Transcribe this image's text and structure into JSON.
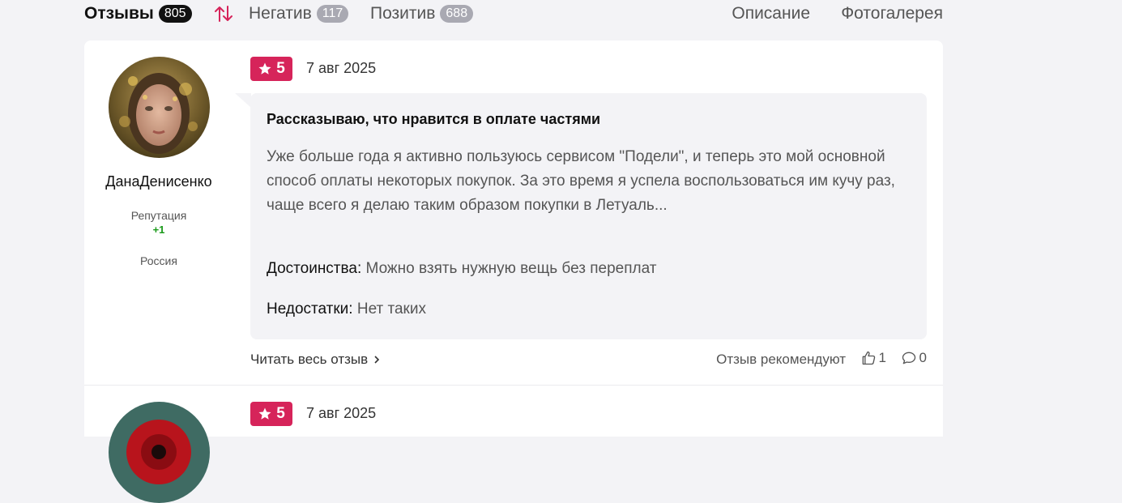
{
  "tabs": {
    "reviews": {
      "label": "Отзывы",
      "count": "805"
    },
    "negative": {
      "label": "Негатив",
      "count": "117"
    },
    "positive": {
      "label": "Позитив",
      "count": "688"
    },
    "description": "Описание",
    "gallery": "Фотогалерея"
  },
  "reviews": [
    {
      "author": "ДанаДенисенко",
      "reputation_label": "Репутация",
      "reputation_value": "+1",
      "country": "Россия",
      "rating": "5",
      "date": "7 авг 2025",
      "title": "Рассказываю, что нравится в оплате частями",
      "text": "Уже больше года я активно пользуюсь сервисом \"Подели\", и теперь это мой основной способ оплаты некоторых покупок. За это время я успела воспользоваться им кучу раз, чаще всего я делаю таким образом покупки в Летуаль...",
      "pros_label": "Достоинства:",
      "pros": "Можно взять нужную вещь без переплат",
      "cons_label": "Недостатки:",
      "cons": "Нет таких",
      "read_more": "Читать весь отзыв",
      "recommend_label": "Отзыв рекомендуют",
      "likes": "1",
      "comments": "0"
    },
    {
      "rating": "5",
      "date": "7 авг 2025"
    }
  ],
  "colors": {
    "accent": "#d6245a",
    "background": "#f3f3f6",
    "reputation": "#1a9a1a"
  },
  "icons": [
    "close-icon",
    "sort-icon",
    "star-icon",
    "chevron-right-icon",
    "thumb-up-icon",
    "comment-icon"
  ]
}
